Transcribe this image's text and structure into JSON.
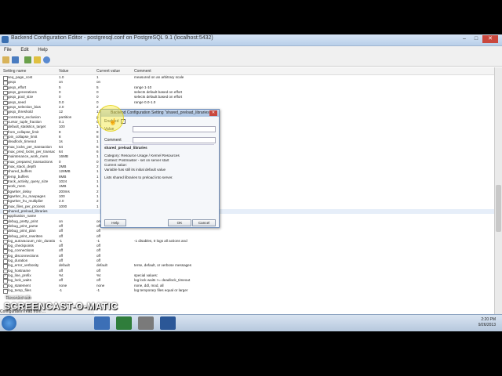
{
  "window": {
    "title": "Backend Configuration Editor - postgresql.conf on PostgreSQL 9.1 (localhost:5432)",
    "minimize": "–",
    "maximize": "□",
    "close": "✕"
  },
  "menu": [
    "File",
    "Edit",
    "Help"
  ],
  "columns": [
    "Setting name",
    "Value",
    "Current value",
    "Comment"
  ],
  "rows": [
    {
      "n": "seq_page_cost",
      "v": "1.0",
      "c": "1",
      "m": "measured on an arbitrary scale"
    },
    {
      "n": "geqo",
      "v": "on",
      "c": "on",
      "m": ""
    },
    {
      "n": "geqo_effort",
      "v": "5",
      "c": "5",
      "m": "range 1-10"
    },
    {
      "n": "geqo_generations",
      "v": "0",
      "c": "0",
      "m": "selects default based on effort"
    },
    {
      "n": "geqo_pool_size",
      "v": "0",
      "c": "0",
      "m": "selects default based on effort"
    },
    {
      "n": "geqo_seed",
      "v": "0.0",
      "c": "0",
      "m": "range 0.0-1.0"
    },
    {
      "n": "geqo_selection_bias",
      "v": "2.0",
      "c": "2",
      "m": ""
    },
    {
      "n": "geqo_threshold",
      "v": "12",
      "c": "12",
      "m": ""
    },
    {
      "n": "constraint_exclusion",
      "v": "partition",
      "c": "p",
      "m": ""
    },
    {
      "n": "cursor_tuple_fraction",
      "v": "0.1",
      "c": "0",
      "m": ""
    },
    {
      "n": "default_statistics_target",
      "v": "100",
      "c": "1",
      "m": ""
    },
    {
      "n": "from_collapse_limit",
      "v": "8",
      "c": "8",
      "m": ""
    },
    {
      "n": "join_collapse_limit",
      "v": "8",
      "c": "8",
      "m": ""
    },
    {
      "n": "deadlock_timeout",
      "v": "1s",
      "c": "1",
      "m": ""
    },
    {
      "n": "max_locks_per_transaction",
      "v": "64",
      "c": "6",
      "m": ""
    },
    {
      "n": "max_pred_locks_per_transac...",
      "v": "64",
      "c": "6",
      "m": ""
    },
    {
      "n": "maintenance_work_mem",
      "v": "16MB",
      "c": "1",
      "m": ""
    },
    {
      "n": "max_prepared_transactions",
      "v": "0",
      "c": "0",
      "m": ""
    },
    {
      "n": "max_stack_depth",
      "v": "2MB",
      "c": "2",
      "m": ""
    },
    {
      "n": "shared_buffers",
      "v": "128MB",
      "c": "1",
      "m": ""
    },
    {
      "n": "temp_buffers",
      "v": "8MB",
      "c": "1",
      "m": ""
    },
    {
      "n": "track_activity_query_size",
      "v": "1024",
      "c": "1",
      "m": ""
    },
    {
      "n": "work_mem",
      "v": "1MB",
      "c": "1",
      "m": ""
    },
    {
      "n": "bgwriter_delay",
      "v": "200ms",
      "c": "2",
      "m": ""
    },
    {
      "n": "bgwriter_lru_maxpages",
      "v": "100",
      "c": "1",
      "m": ""
    },
    {
      "n": "bgwriter_lru_multiplier",
      "v": "2.0",
      "c": "2",
      "m": ""
    },
    {
      "n": "max_files_per_process",
      "v": "1000",
      "c": "1",
      "m": ""
    },
    {
      "n": "shared_preload_libraries",
      "v": "",
      "c": "",
      "m": ""
    },
    {
      "n": "application_name",
      "v": "",
      "c": "",
      "m": ""
    },
    {
      "n": "debug_pretty_print",
      "v": "on",
      "c": "on",
      "m": ""
    },
    {
      "n": "debug_print_parse",
      "v": "off",
      "c": "off",
      "m": ""
    },
    {
      "n": "debug_print_plan",
      "v": "off",
      "c": "off",
      "m": ""
    },
    {
      "n": "debug_print_rewritten",
      "v": "off",
      "c": "off",
      "m": ""
    },
    {
      "n": "log_autovacuum_min_duration",
      "v": "-1",
      "c": "-1",
      "m": "-1 disables, 0 logs all actions and"
    },
    {
      "n": "log_checkpoints",
      "v": "off",
      "c": "off",
      "m": ""
    },
    {
      "n": "log_connections",
      "v": "off",
      "c": "off",
      "m": ""
    },
    {
      "n": "log_disconnections",
      "v": "off",
      "c": "off",
      "m": ""
    },
    {
      "n": "log_duration",
      "v": "off",
      "c": "off",
      "m": ""
    },
    {
      "n": "log_error_verbosity",
      "v": "default",
      "c": "default",
      "m": "terse, default, or verbose messages"
    },
    {
      "n": "log_hostname",
      "v": "off",
      "c": "off",
      "m": ""
    },
    {
      "n": "log_line_prefix",
      "v": "%t",
      "c": "%t",
      "m": "special values:"
    },
    {
      "n": "log_lock_waits",
      "v": "off",
      "c": "off",
      "m": "log lock waits >= deadlock_timeout"
    },
    {
      "n": "log_statement",
      "v": "none",
      "c": "none",
      "m": "none, ddl, mod, all"
    },
    {
      "n": "log_temp_files",
      "v": "-1",
      "c": "-1",
      "m": "log temporary files equal or larger"
    }
  ],
  "status": "Configuration read from ...",
  "dialog": {
    "title": "Backend Configuration Setting \"shared_preload_libraries\"",
    "close": "✕",
    "enabled_label": "Enabled",
    "value_label": "Value",
    "comment_label": "Comment",
    "setting_name": "shared_preload_libraries",
    "info": [
      "Category: Resource Usage / Kernel Resources",
      "Context: Postmaster - set on server start",
      "Current value:",
      "   Variable has still its initial default value"
    ],
    "description": "Lists shared libraries to preload into server.",
    "help_btn": "Help",
    "ok_btn": "OK",
    "cancel_btn": "Cancel"
  },
  "tray": {
    "time": "2:20 PM",
    "date": "9/26/2013"
  },
  "watermark": {
    "main": "SCREENCAST-O-MATIC",
    "sub": "Recorded with"
  },
  "colors": {
    "accent": "#3a6fb0",
    "selection": "#e6eef9",
    "highlight": "#fff03c"
  }
}
